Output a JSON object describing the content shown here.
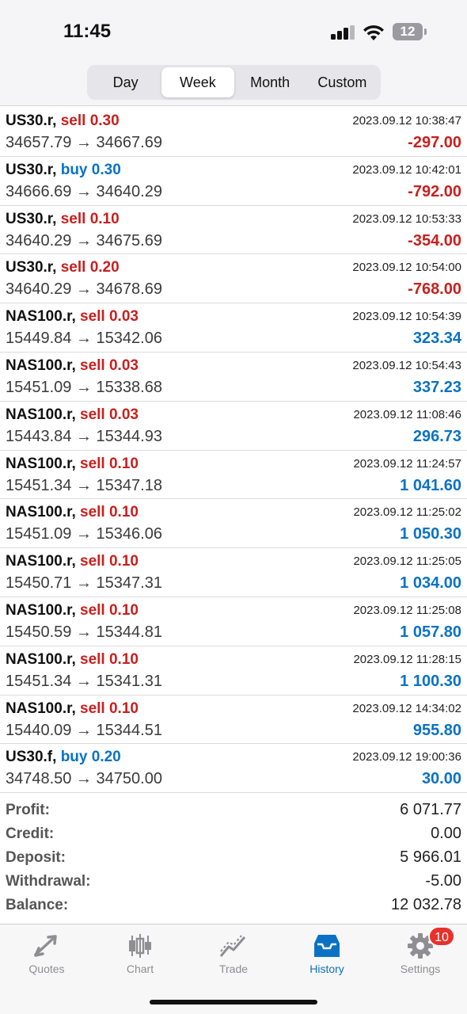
{
  "status": {
    "time": "11:45",
    "battery": "12"
  },
  "period_tabs": [
    {
      "label": "Day",
      "active": false
    },
    {
      "label": "Week",
      "active": true
    },
    {
      "label": "Month",
      "active": false
    },
    {
      "label": "Custom",
      "active": false
    }
  ],
  "deals": [
    {
      "symbol": "US30.r,",
      "side": "sell 0.30",
      "type": "sell",
      "time": "2023.09.12 10:38:47",
      "prices": "34657.79 → 34667.69",
      "profit": "-297.00",
      "sign": "neg"
    },
    {
      "symbol": "US30.r,",
      "side": "buy 0.30",
      "type": "buy",
      "time": "2023.09.12 10:42:01",
      "prices": "34666.69 → 34640.29",
      "profit": "-792.00",
      "sign": "neg"
    },
    {
      "symbol": "US30.r,",
      "side": "sell 0.10",
      "type": "sell",
      "time": "2023.09.12 10:53:33",
      "prices": "34640.29 → 34675.69",
      "profit": "-354.00",
      "sign": "neg"
    },
    {
      "symbol": "US30.r,",
      "side": "sell 0.20",
      "type": "sell",
      "time": "2023.09.12 10:54:00",
      "prices": "34640.29 → 34678.69",
      "profit": "-768.00",
      "sign": "neg"
    },
    {
      "symbol": "NAS100.r,",
      "side": "sell 0.03",
      "type": "sell",
      "time": "2023.09.12 10:54:39",
      "prices": "15449.84 → 15342.06",
      "profit": "323.34",
      "sign": "pos"
    },
    {
      "symbol": "NAS100.r,",
      "side": "sell 0.03",
      "type": "sell",
      "time": "2023.09.12 10:54:43",
      "prices": "15451.09 → 15338.68",
      "profit": "337.23",
      "sign": "pos"
    },
    {
      "symbol": "NAS100.r,",
      "side": "sell 0.03",
      "type": "sell",
      "time": "2023.09.12 11:08:46",
      "prices": "15443.84 → 15344.93",
      "profit": "296.73",
      "sign": "pos"
    },
    {
      "symbol": "NAS100.r,",
      "side": "sell 0.10",
      "type": "sell",
      "time": "2023.09.12 11:24:57",
      "prices": "15451.34 → 15347.18",
      "profit": "1 041.60",
      "sign": "pos"
    },
    {
      "symbol": "NAS100.r,",
      "side": "sell 0.10",
      "type": "sell",
      "time": "2023.09.12 11:25:02",
      "prices": "15451.09 → 15346.06",
      "profit": "1 050.30",
      "sign": "pos"
    },
    {
      "symbol": "NAS100.r,",
      "side": "sell 0.10",
      "type": "sell",
      "time": "2023.09.12 11:25:05",
      "prices": "15450.71 → 15347.31",
      "profit": "1 034.00",
      "sign": "pos"
    },
    {
      "symbol": "NAS100.r,",
      "side": "sell 0.10",
      "type": "sell",
      "time": "2023.09.12 11:25:08",
      "prices": "15450.59 → 15344.81",
      "profit": "1 057.80",
      "sign": "pos"
    },
    {
      "symbol": "NAS100.r,",
      "side": "sell 0.10",
      "type": "sell",
      "time": "2023.09.12 11:28:15",
      "prices": "15451.34 → 15341.31",
      "profit": "1 100.30",
      "sign": "pos"
    },
    {
      "symbol": "NAS100.r,",
      "side": "sell 0.10",
      "type": "sell",
      "time": "2023.09.12 14:34:02",
      "prices": "15440.09 → 15344.51",
      "profit": "955.80",
      "sign": "pos"
    },
    {
      "symbol": "US30.f,",
      "side": "buy 0.20",
      "type": "buy",
      "time": "2023.09.12 19:00:36",
      "prices": "34748.50 → 34750.00",
      "profit": "30.00",
      "sign": "pos"
    }
  ],
  "summary": [
    {
      "label": "Profit:",
      "value": "6 071.77"
    },
    {
      "label": "Credit:",
      "value": "0.00"
    },
    {
      "label": "Deposit:",
      "value": "5 966.01"
    },
    {
      "label": "Withdrawal:",
      "value": "-5.00"
    },
    {
      "label": "Balance:",
      "value": "12 032.78"
    }
  ],
  "tabbar": {
    "items": [
      {
        "label": "Quotes",
        "icon": "quotes-arrows-icon",
        "active": false
      },
      {
        "label": "Chart",
        "icon": "candlestick-chart-icon",
        "active": false
      },
      {
        "label": "Trade",
        "icon": "trade-line-icon",
        "active": false
      },
      {
        "label": "History",
        "icon": "history-inbox-icon",
        "active": true
      },
      {
        "label": "Settings",
        "icon": "gear-icon",
        "active": false
      }
    ],
    "settings_badge": "10"
  },
  "colors": {
    "sell": "#c8201e",
    "buy": "#0a72c4",
    "active_tab": "#0a72c4"
  }
}
